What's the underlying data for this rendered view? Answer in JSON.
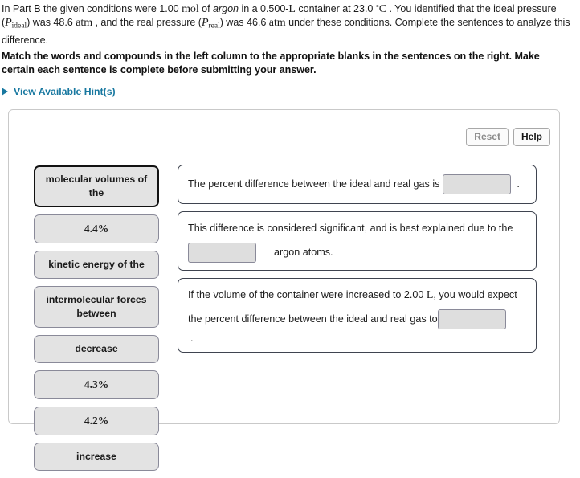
{
  "problem": {
    "line_parts": {
      "p1": "In Part B the given conditions were 1.00 ",
      "unit_mol": "mol",
      "p2": " of ",
      "substance": "argon",
      "p3": " in a 0.500-",
      "unit_L": "L",
      "p4": " container at 23.0 ",
      "deg": "°",
      "unit_C": "C",
      "p5": " . You identified that the ideal pressure (",
      "var_p1": "P",
      "sub1": "ideal",
      "p6": ") was 48.6 ",
      "unit_atm1": "atm",
      "p7": " , and the real pressure (",
      "var_p2": "P",
      "sub2": "real",
      "p8": ") was 46.6 ",
      "unit_atm2": "atm",
      "p9": " under these conditions. Complete the sentences to analyze this difference."
    }
  },
  "instructions": {
    "text": "Match the words and compounds in the left column to the appropriate blanks in the sentences on the right. Make certain each sentence is complete before submitting your answer."
  },
  "hints": {
    "label": "View Available Hint(s)",
    "icon": "triangle-right-icon",
    "color": "#1878a0"
  },
  "panel": {
    "reset_label": "Reset",
    "help_label": "Help"
  },
  "tiles": [
    {
      "label": "molecular volumes of the",
      "selected": true
    },
    {
      "label": "4.4%",
      "selected": false
    },
    {
      "label": "kinetic energy of the",
      "selected": false
    },
    {
      "label": "intermolecular forces between",
      "selected": false
    },
    {
      "label": "decrease",
      "selected": false
    },
    {
      "label": "4.3%",
      "selected": false
    },
    {
      "label": "4.2%",
      "selected": false
    },
    {
      "label": "increase",
      "selected": false
    }
  ],
  "sentences": {
    "s1": {
      "before": "The percent difference between the ideal and real gas is",
      "blank_value": "",
      "after": "."
    },
    "s2": {
      "line1": "This difference is considered significant, and is best explained due to the",
      "blank_value": "",
      "line2_after": "argon atoms."
    },
    "s3": {
      "line1a": "If the volume of the container were increased to 2.00 ",
      "unit_L": "L",
      "line1b": ", you would expect",
      "line2": "the percent difference between the ideal and real gas to",
      "blank_value": "",
      "after": "."
    }
  }
}
